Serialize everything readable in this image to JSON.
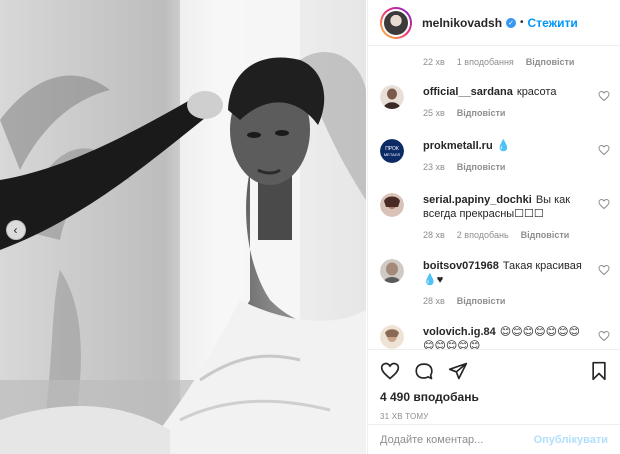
{
  "post": {
    "photo_alt": "Black and white photo",
    "carousel_prev_icon": "chevron-left-icon"
  },
  "header": {
    "username": "melnikovadsh",
    "separator": "•",
    "follow_label": "Стежити"
  },
  "first_comment_meta": {
    "time": "22 хв",
    "likes": "1 вподобання",
    "reply": "Відповісти"
  },
  "comments": [
    {
      "username": "official__sardana",
      "text": "красота",
      "time": "25 хв",
      "likes": "",
      "reply": "Відповісти"
    },
    {
      "username": "prokmetall.ru",
      "text": "💧",
      "time": "23 хв",
      "likes": "",
      "reply": "Відповісти"
    },
    {
      "username": "serial.papiny_dochki",
      "text": "Вы как всегда прекрасны☐☐☐",
      "time": "28 хв",
      "likes": "2 вподобань",
      "reply": "Відповісти"
    },
    {
      "username": "boitsov071968",
      "text": "Такая красивая 💧♥",
      "time": "28 хв",
      "likes": "",
      "reply": "Відповісти"
    },
    {
      "username": "volovich.ig.84",
      "text": "😊😊😊😊😊😊😊😊😊😊😊😊",
      "time": "",
      "likes": "",
      "reply": ""
    }
  ],
  "actions": {
    "likes_count": "4 490 вподобань",
    "posted_time": "31 ХВ ТОМУ"
  },
  "add_comment": {
    "placeholder": "Додайте коментар...",
    "publish_label": "Опублікувати"
  },
  "colors": {
    "accent": "#0095f6",
    "publish_disabled": "#b2dffc",
    "muted": "#8e8e8e"
  }
}
